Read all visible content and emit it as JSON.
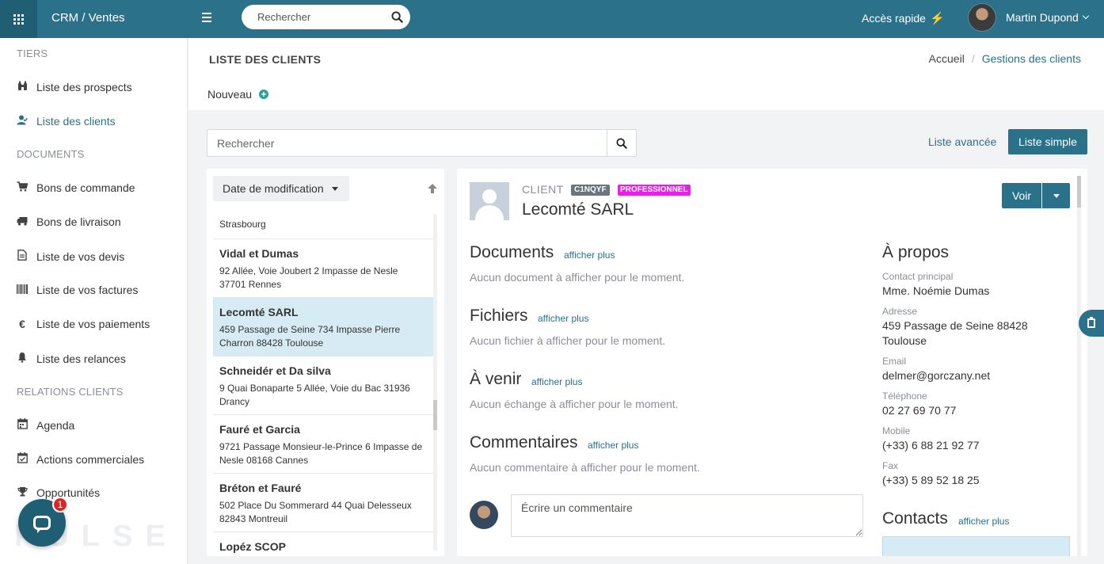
{
  "topbar": {
    "app_title": "CRM / Ventes",
    "search_placeholder": "Rechercher",
    "quick_access": "Accès rapide",
    "user_name": "Martin Dupond"
  },
  "sidebar": {
    "sections": [
      "TIERS",
      "DOCUMENTS",
      "RELATIONS CLIENTS"
    ],
    "items": [
      {
        "label": "Liste des prospects",
        "icon": "binoculars-icon"
      },
      {
        "label": "Liste des clients",
        "icon": "user-check-icon",
        "active": true
      },
      {
        "label": "Bons de commande",
        "icon": "cart-icon"
      },
      {
        "label": "Bons de livraison",
        "icon": "truck-icon"
      },
      {
        "label": "Liste de vos devis",
        "icon": "document-icon"
      },
      {
        "label": "Liste de vos factures",
        "icon": "barcode-icon"
      },
      {
        "label": "Liste de vos paiements",
        "icon": "euro-icon"
      },
      {
        "label": "Liste des relances",
        "icon": "bell-icon"
      },
      {
        "label": "Agenda",
        "icon": "calendar-icon"
      },
      {
        "label": "Actions commerciales",
        "icon": "calendar-check-icon"
      },
      {
        "label": "Opportunités",
        "icon": "trophy-icon"
      }
    ],
    "logo_text": "PULSE",
    "chat_badge": "1"
  },
  "header": {
    "title": "LISTE DES CLIENTS",
    "breadcrumb_home": "Accueil",
    "breadcrumb_sep": "/",
    "breadcrumb_current": "Gestions des clients",
    "new_label": "Nouveau"
  },
  "toolbar": {
    "search_placeholder": "Rechercher",
    "advanced_list": "Liste avancée",
    "simple_list": "Liste simple"
  },
  "list": {
    "sort_label": "Date de modification",
    "items": [
      {
        "name": "",
        "address": "Strasbourg"
      },
      {
        "name": "Vidal et Dumas",
        "address": "92 Allée, Voie Joubert 2 Impasse de Nesle 37701 Rennes"
      },
      {
        "name": "Lecomté SARL",
        "address": "459 Passage de Seine 734 Impasse Pierre Charron 88428 Toulouse",
        "selected": true
      },
      {
        "name": "Schneidér et Da silva",
        "address": "9 Quai Bonaparte 5 Allée, Voie du Bac 31936 Drancy"
      },
      {
        "name": "Fauré et Garcia",
        "address": "9721 Passage Monsieur-le-Prince 6 Impasse de Nesle 08168 Cannes"
      },
      {
        "name": "Bréton et Fauré",
        "address": "502 Place Du Sommerard 44 Quai Delesseux 82843 Montreuil"
      },
      {
        "name": "Lopéz SCOP",
        "address": ""
      }
    ]
  },
  "detail": {
    "label": "CLIENT",
    "code": "C1NQYF",
    "type_badge": "PROFESSIONNEL",
    "name": "Lecomté SARL",
    "view_button": "Voir",
    "sections": [
      {
        "title": "Documents",
        "more": "afficher plus",
        "empty": "Aucun document à afficher pour le moment."
      },
      {
        "title": "Fichiers",
        "more": "afficher plus",
        "empty": "Aucun fichier à afficher pour le moment."
      },
      {
        "title": "À venir",
        "more": "afficher plus",
        "empty": "Aucun échange à afficher pour le moment."
      },
      {
        "title": "Commentaires",
        "more": "afficher plus",
        "empty": "Aucun commentaire à afficher pour le moment."
      }
    ],
    "comment_placeholder": "Écrire un commentaire",
    "about": {
      "title": "À propos",
      "contact_label": "Contact principal",
      "contact": "Mme. Noémie Dumas",
      "address_label": "Adresse",
      "address_line1": "459 Passage de Seine 88428",
      "address_line2": "Toulouse",
      "email_label": "Email",
      "email": "delmer@gorczany.net",
      "phone_label": "Téléphone",
      "phone": "02 27 69 70 77",
      "mobile_label": "Mobile",
      "mobile": "(+33) 6 88 21 92 77",
      "fax_label": "Fax",
      "fax": "(+33) 5 89 52 18 25"
    },
    "contacts_title": "Contacts",
    "contacts_more": "afficher plus"
  },
  "colors": {
    "primary": "#2a7189",
    "primary_dark": "#1f5e73",
    "selected_row": "#d6ebf3",
    "pro_badge": "#e91ee9"
  }
}
